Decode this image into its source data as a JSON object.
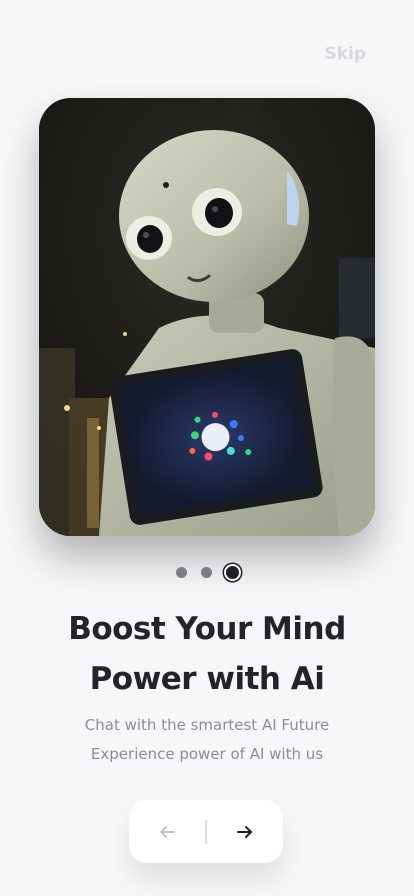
{
  "header": {
    "skip_label": "Skip"
  },
  "hero": {
    "image": "robot-with-tablet-photo"
  },
  "pagination": {
    "total": 3,
    "active_index": 3
  },
  "content": {
    "title_line1": "Boost Your Mind",
    "title_line2": "Power with Ai",
    "subtitle_line1": "Chat with the smartest AI Future",
    "subtitle_line2": "Experience power of AI with us"
  },
  "navigation": {
    "back_icon": "arrow-left-icon",
    "next_icon": "arrow-right-icon"
  },
  "colors": {
    "background": "#f6f7f9",
    "title": "#22242a",
    "subtitle": "#8b8e93",
    "skip": "#d6d8dc",
    "active_dot": "#1d1f24",
    "inactive_dot": "#7b7d82"
  }
}
